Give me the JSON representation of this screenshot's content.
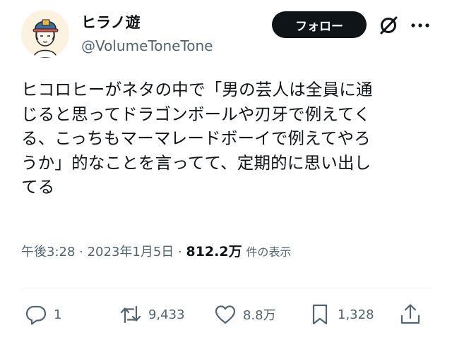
{
  "user": {
    "display_name": "ヒラノ遊",
    "handle": "@VolumeToneTone",
    "avatar_icon": "avatar-illustration"
  },
  "header": {
    "follow_label": "フォロー",
    "grok_icon": "grok-icon",
    "more_icon": "more-icon"
  },
  "tweet": {
    "text": "ヒコロヒーがネタの中で「男の芸人は全員に通\nじると思ってドラゴンボールや刃牙で例えてく\nる、こっちもマーマレードボーイで例えてやろ\nうか」的なことを言ってて、定期的に思い出し\nてる"
  },
  "meta": {
    "time": "午後3:28",
    "separator1": " · ",
    "date": "2023年1月5日",
    "separator2": " · ",
    "views_count": "812.2万",
    "views_label": "件の表示"
  },
  "actions": {
    "reply": {
      "icon": "reply-icon",
      "count": "1"
    },
    "retweet": {
      "icon": "retweet-icon",
      "count": "9,433"
    },
    "like": {
      "icon": "like-icon",
      "count": "8.8万"
    },
    "bookmark": {
      "icon": "bookmark-icon",
      "count": "1,328"
    },
    "share": {
      "icon": "share-icon"
    }
  },
  "colors": {
    "text": "#0f1419",
    "secondary": "#536471",
    "button_bg": "#0f1419",
    "button_text": "#ffffff",
    "divider": "#eff3f4"
  }
}
